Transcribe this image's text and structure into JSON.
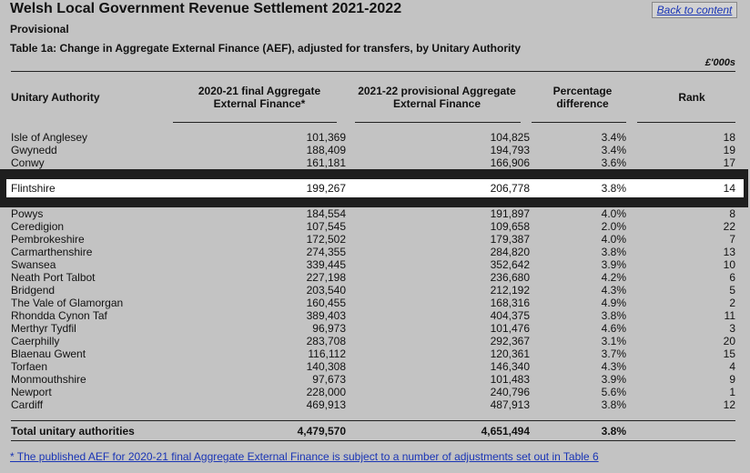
{
  "header": {
    "title": "Welsh Local Government Revenue Settlement 2021-2022",
    "status": "Provisional",
    "table_title": "Table 1a: Change in Aggregate External Finance (AEF), adjusted for transfers, by Unitary Authority",
    "back_link": "Back to content",
    "units": "£'000s"
  },
  "columns": {
    "authority": "Unitary Authority",
    "aef_2021": "2020-21 final Aggregate External Finance*",
    "aef_2122": "2021-22 provisional Aggregate External Finance",
    "pct": "Percentage difference",
    "rank": "Rank"
  },
  "rows_top": [
    {
      "name": "Isle of Anglesey",
      "a": "101,369",
      "b": "104,825",
      "p": "3.4%",
      "r": "18"
    },
    {
      "name": "Gwynedd",
      "a": "188,409",
      "b": "194,793",
      "p": "3.4%",
      "r": "19"
    },
    {
      "name": "Conwy",
      "a": "161,181",
      "b": "166,906",
      "p": "3.6%",
      "r": "17"
    }
  ],
  "highlight": {
    "name": "Flintshire",
    "a": "199,267",
    "b": "206,778",
    "p": "3.8%",
    "r": "14"
  },
  "rows_bottom": [
    {
      "name": "Powys",
      "a": "184,554",
      "b": "191,897",
      "p": "4.0%",
      "r": "8"
    },
    {
      "name": "Ceredigion",
      "a": "107,545",
      "b": "109,658",
      "p": "2.0%",
      "r": "22"
    },
    {
      "name": "Pembrokeshire",
      "a": "172,502",
      "b": "179,387",
      "p": "4.0%",
      "r": "7"
    },
    {
      "name": "Carmarthenshire",
      "a": "274,355",
      "b": "284,820",
      "p": "3.8%",
      "r": "13"
    },
    {
      "name": "Swansea",
      "a": "339,445",
      "b": "352,642",
      "p": "3.9%",
      "r": "10"
    },
    {
      "name": "Neath Port Talbot",
      "a": "227,198",
      "b": "236,680",
      "p": "4.2%",
      "r": "6"
    },
    {
      "name": "Bridgend",
      "a": "203,540",
      "b": "212,192",
      "p": "4.3%",
      "r": "5"
    },
    {
      "name": "The Vale of Glamorgan",
      "a": "160,455",
      "b": "168,316",
      "p": "4.9%",
      "r": "2"
    },
    {
      "name": "Rhondda Cynon Taf",
      "a": "389,403",
      "b": "404,375",
      "p": "3.8%",
      "r": "11"
    },
    {
      "name": "Merthyr Tydfil",
      "a": "96,973",
      "b": "101,476",
      "p": "4.6%",
      "r": "3"
    },
    {
      "name": "Caerphilly",
      "a": "283,708",
      "b": "292,367",
      "p": "3.1%",
      "r": "20"
    },
    {
      "name": "Blaenau Gwent",
      "a": "116,112",
      "b": "120,361",
      "p": "3.7%",
      "r": "15"
    },
    {
      "name": "Torfaen",
      "a": "140,308",
      "b": "146,340",
      "p": "4.3%",
      "r": "4"
    },
    {
      "name": "Monmouthshire",
      "a": "97,673",
      "b": "101,483",
      "p": "3.9%",
      "r": "9"
    },
    {
      "name": "Newport",
      "a": "228,000",
      "b": "240,796",
      "p": "5.6%",
      "r": "1"
    },
    {
      "name": "Cardiff",
      "a": "469,913",
      "b": "487,913",
      "p": "3.8%",
      "r": "12"
    }
  ],
  "total": {
    "name": "Total unitary authorities",
    "a": "4,479,570",
    "b": "4,651,494",
    "p": "3.8%"
  },
  "footnote": "* The published AEF for 2020-21 final Aggregate External Finance is subject to a number of adjustments set out in Table 6"
}
